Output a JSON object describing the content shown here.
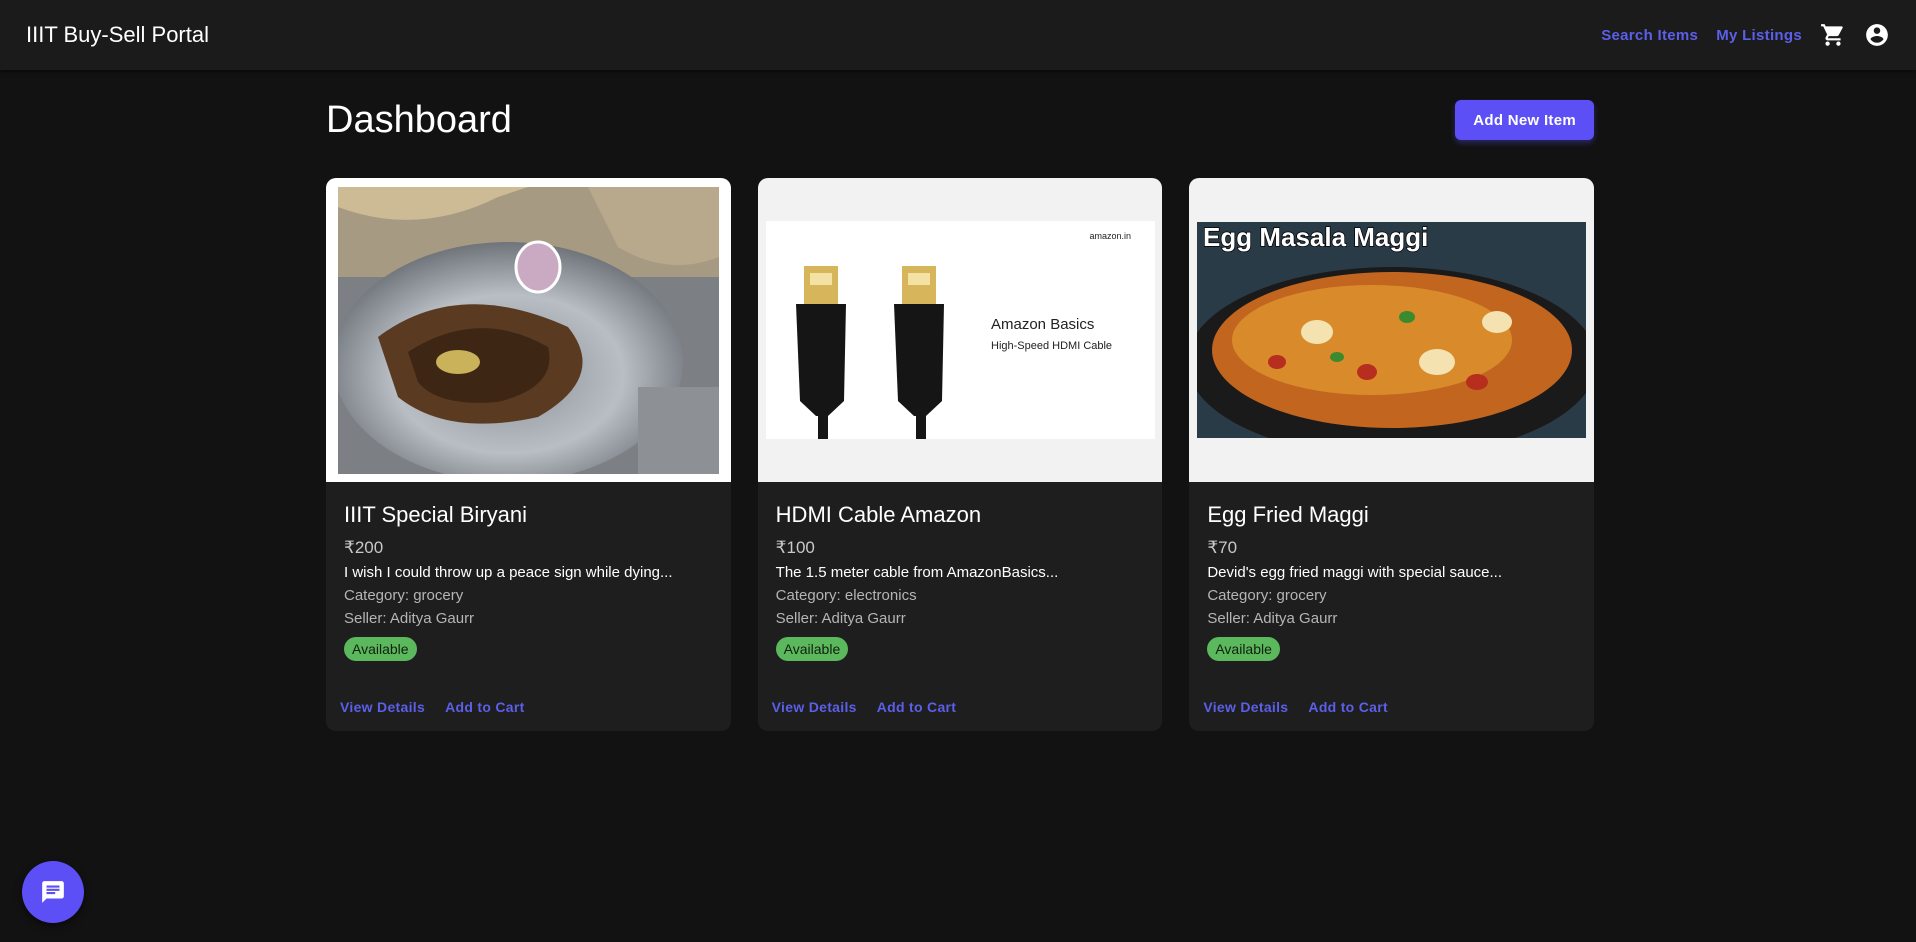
{
  "appbar": {
    "brand": "IIIT Buy-Sell Portal",
    "links": [
      "Search Items",
      "My Listings"
    ],
    "icons": [
      "cart-icon",
      "account-icon"
    ]
  },
  "page": {
    "title": "Dashboard",
    "add_button": "Add New Item"
  },
  "items": [
    {
      "image_icon": "biryani-photo",
      "title": "IIIT Special Biryani",
      "price": "₹200",
      "description": "I wish I could throw up a peace sign while dying...",
      "category": "Category: grocery",
      "seller": "Seller: Aditya Gaurr",
      "status": "Available",
      "view_label": "View Details",
      "cart_label": "Add to Cart"
    },
    {
      "image_icon": "hdmi-cable-photo",
      "image_brand": "amazon.in",
      "image_heading": "Amazon Basics",
      "image_sub": "High-Speed HDMI Cable",
      "title": "HDMI Cable Amazon",
      "price": "₹100",
      "description": "The 1.5 meter cable from AmazonBasics...",
      "category": "Category: electronics",
      "seller": "Seller: Aditya Gaurr",
      "status": "Available",
      "view_label": "View Details",
      "cart_label": "Add to Cart"
    },
    {
      "image_icon": "maggi-photo",
      "image_caption": "Egg Masala Maggi",
      "title": "Egg Fried Maggi",
      "price": "₹70",
      "description": "Devid's egg fried maggi with special sauce...",
      "category": "Category: grocery",
      "seller": "Seller: Aditya Gaurr",
      "status": "Available",
      "view_label": "View Details",
      "cart_label": "Add to Cart"
    }
  ],
  "colors": {
    "accent": "#5b4ff5",
    "link": "#5b5fe9",
    "available": "#5cb85c",
    "background": "#121212",
    "card": "#1e1e1e"
  },
  "fab_icon": "chat-icon"
}
